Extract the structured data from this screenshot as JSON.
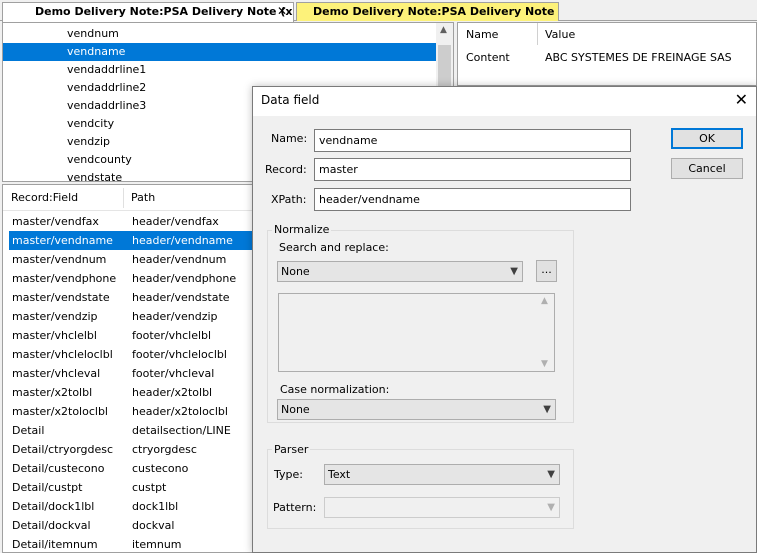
{
  "tabs": [
    {
      "label": "Demo Delivery Note:PSA Delivery Note (xml)",
      "close": "✕"
    },
    {
      "label": "Demo Delivery Note:PSA Delivery Note (form)"
    }
  ],
  "tree": {
    "items": [
      "vendnum",
      "vendname",
      "vendaddrline1",
      "vendaddrline2",
      "vendaddrline3",
      "vendcity",
      "vendzip",
      "vendcounty",
      "vendstate"
    ],
    "selected_index": 1
  },
  "properties": {
    "col_name": "Name",
    "col_value": "Value",
    "rows": [
      {
        "name": "Content",
        "value": "ABC SYSTEMES DE FREINAGE SAS"
      }
    ]
  },
  "fields": {
    "col_record_field": "Record:Field",
    "col_path": "Path",
    "selected_index": 1,
    "rows": [
      {
        "field": "master/vendfax",
        "path": "header/vendfax"
      },
      {
        "field": "master/vendname",
        "path": "header/vendname"
      },
      {
        "field": "master/vendnum",
        "path": "header/vendnum"
      },
      {
        "field": "master/vendphone",
        "path": "header/vendphone"
      },
      {
        "field": "master/vendstate",
        "path": "header/vendstate"
      },
      {
        "field": "master/vendzip",
        "path": "header/vendzip"
      },
      {
        "field": "master/vhclelbl",
        "path": "footer/vhclelbl"
      },
      {
        "field": "master/vhcleloclbl",
        "path": "footer/vhcleloclbl"
      },
      {
        "field": "master/vhcleval",
        "path": "footer/vhcleval"
      },
      {
        "field": "master/x2tolbl",
        "path": "header/x2tolbl"
      },
      {
        "field": "master/x2toloclbl",
        "path": "header/x2toloclbl"
      },
      {
        "field": "Detail",
        "path": "detailsection/LINE"
      },
      {
        "field": "Detail/ctryorgdesc",
        "path": "ctryorgdesc"
      },
      {
        "field": "Detail/custecono",
        "path": "custecono"
      },
      {
        "field": "Detail/custpt",
        "path": "custpt"
      },
      {
        "field": "Detail/dock1lbl",
        "path": "dock1lbl"
      },
      {
        "field": "Detail/dockval",
        "path": "dockval"
      },
      {
        "field": "Detail/itemnum",
        "path": "itemnum"
      }
    ]
  },
  "dialog": {
    "title": "Data field",
    "close": "✕",
    "name_label": "Name:",
    "name_value": "vendname",
    "record_label": "Record:",
    "record_value": "master",
    "xpath_label": "XPath:",
    "xpath_value": "header/vendname",
    "ok_label": "OK",
    "cancel_label": "Cancel",
    "normalize": {
      "group_title": "Normalize",
      "search_replace_label": "Search and replace:",
      "search_replace_value": "None",
      "browse_label": "...",
      "case_label": "Case normalization:",
      "case_value": "None"
    },
    "parser": {
      "group_title": "Parser",
      "type_label": "Type:",
      "type_value": "Text",
      "pattern_label": "Pattern:",
      "pattern_value": ""
    }
  },
  "colors": {
    "selection": "#0078d7",
    "inactive_tab": "#fdf27a",
    "default_button_border": "#0078d7"
  }
}
